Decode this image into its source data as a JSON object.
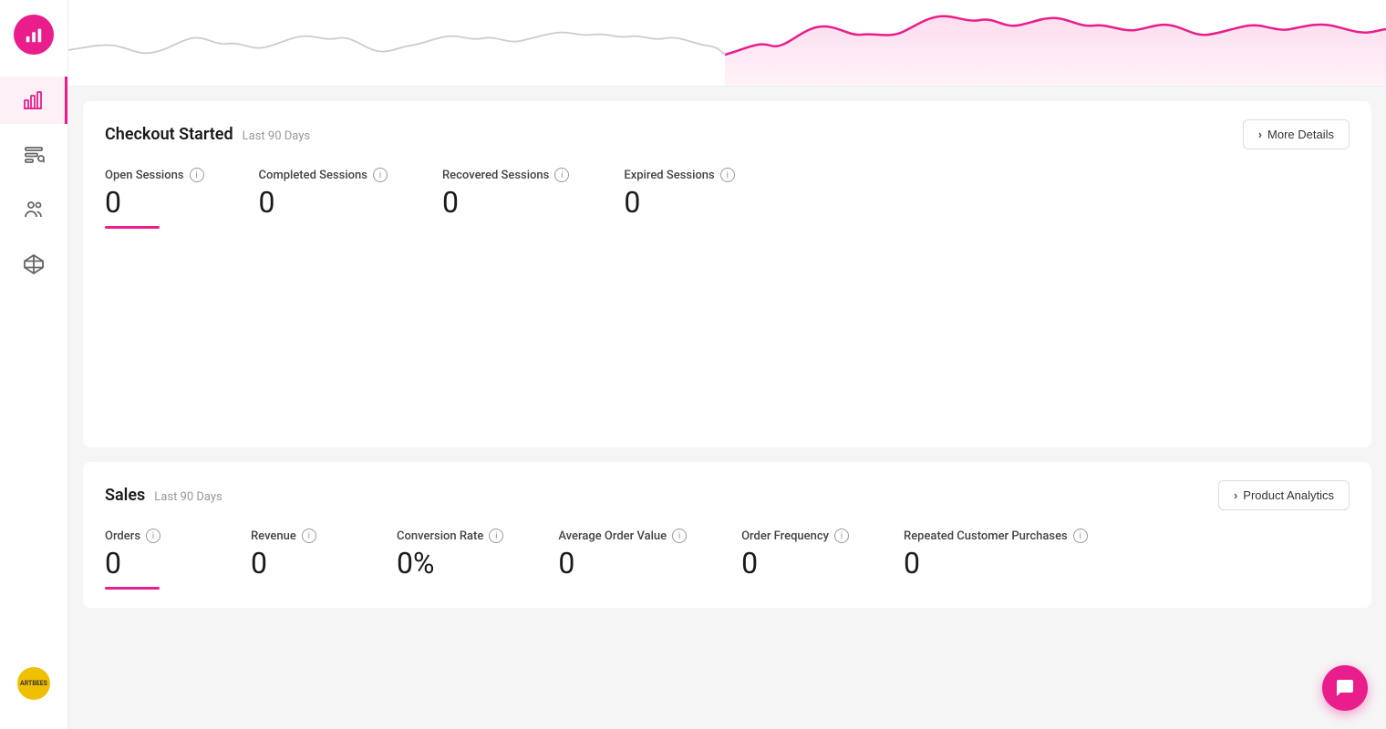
{
  "sidebar": {
    "logo": "chart-icon",
    "nav_items": [
      {
        "id": "analytics",
        "icon": "bar-chart",
        "active": true
      },
      {
        "id": "segments",
        "icon": "filter",
        "active": false
      },
      {
        "id": "audience",
        "icon": "users",
        "active": false
      },
      {
        "id": "products",
        "icon": "box",
        "active": false
      }
    ],
    "avatar_text": "ARTBEES"
  },
  "checkout": {
    "title": "Checkout Started",
    "subtitle": "Last 90 Days",
    "more_details_label": "More Details",
    "stats": [
      {
        "id": "open",
        "label": "Open Sessions",
        "value": "0",
        "has_underline": true
      },
      {
        "id": "completed",
        "label": "Completed Sessions",
        "value": "0",
        "has_underline": false
      },
      {
        "id": "recovered",
        "label": "Recovered Sessions",
        "value": "0",
        "has_underline": false
      },
      {
        "id": "expired",
        "label": "Expired Sessions",
        "value": "0",
        "has_underline": false
      }
    ]
  },
  "sales": {
    "title": "Sales",
    "subtitle": "Last 90 Days",
    "product_analytics_label": "Product Analytics",
    "stats": [
      {
        "id": "orders",
        "label": "Orders",
        "value": "0",
        "has_underline": true
      },
      {
        "id": "revenue",
        "label": "Revenue",
        "value": "0",
        "has_underline": false
      },
      {
        "id": "conversion_rate",
        "label": "Conversion Rate",
        "value": "0%",
        "has_underline": false
      },
      {
        "id": "avg_order_value",
        "label": "Average Order Value",
        "value": "0",
        "has_underline": false
      },
      {
        "id": "order_frequency",
        "label": "Order Frequency",
        "value": "0",
        "has_underline": false
      },
      {
        "id": "repeated_purchases",
        "label": "Repeated Customer Purchases",
        "value": "0",
        "has_underline": false
      }
    ]
  },
  "colors": {
    "accent": "#e91e8c",
    "accent_light": "#fce4f3"
  }
}
